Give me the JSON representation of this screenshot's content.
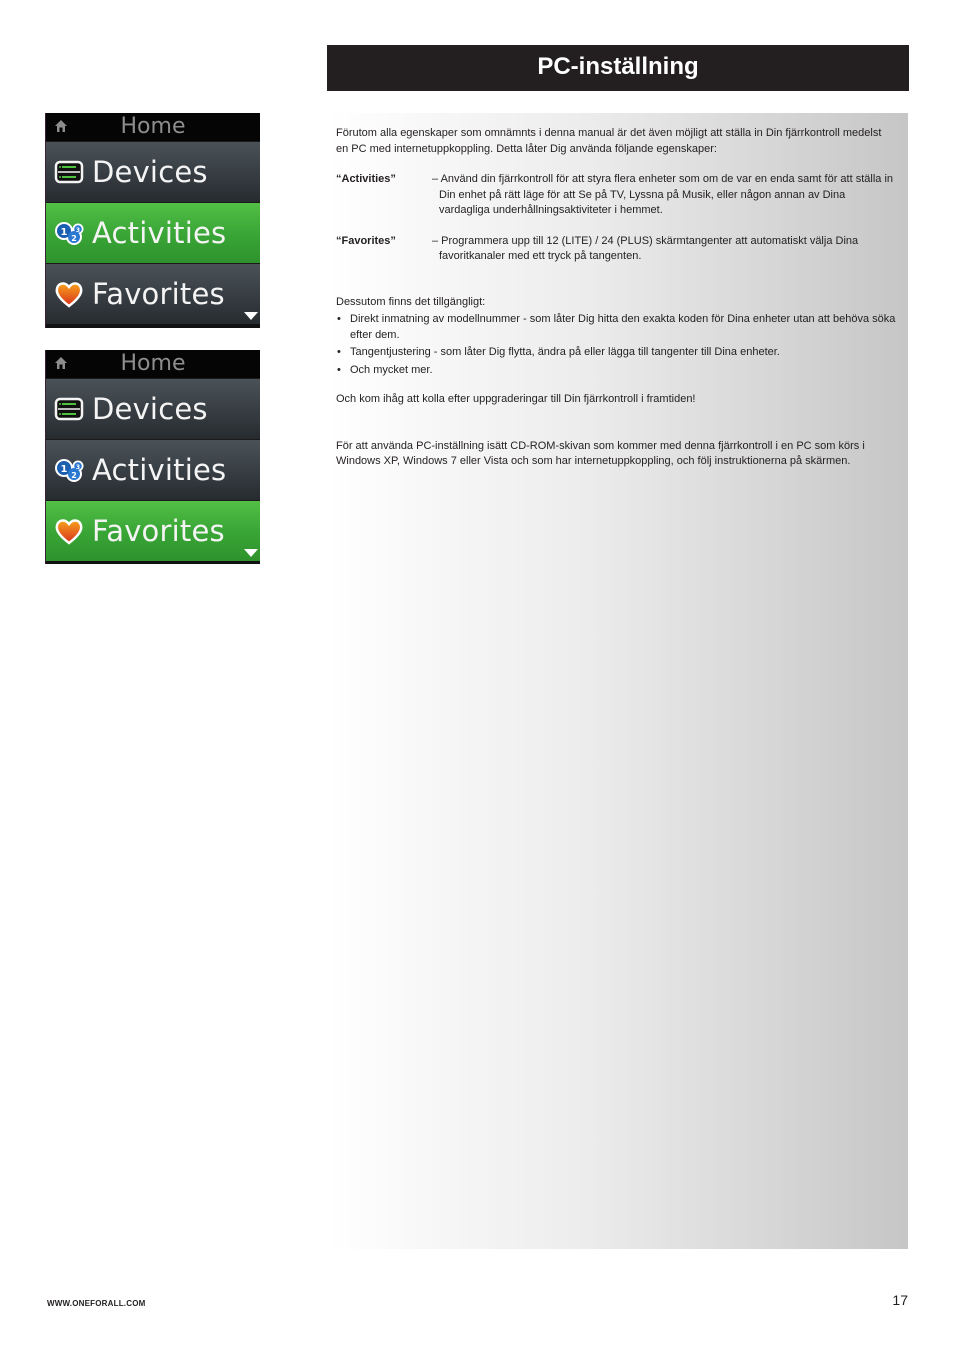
{
  "header": {
    "title": "PC-inställning"
  },
  "screens": [
    {
      "title": "Home",
      "items": [
        {
          "label": "Devices",
          "icon": "devices-icon",
          "selected": false
        },
        {
          "label": "Activities",
          "icon": "activities-icon",
          "selected": true
        },
        {
          "label": "Favorites",
          "icon": "heart-icon",
          "selected": false
        }
      ]
    },
    {
      "title": "Home",
      "items": [
        {
          "label": "Devices",
          "icon": "devices-icon",
          "selected": false
        },
        {
          "label": "Activities",
          "icon": "activities-icon",
          "selected": false
        },
        {
          "label": "Favorites",
          "icon": "heart-icon",
          "selected": true
        }
      ]
    }
  ],
  "colors": {
    "title_bar": "#231f20",
    "selected_item": "#3aa637",
    "unselected_item": "#3a4146",
    "panel_gradient_end": "#c6c6c6"
  },
  "body": {
    "intro": "Förutom alla egenskaper som omnämnts i denna manual är det även möjligt att ställa in Din fjärrkontroll medelst en PC med internetuppkoppling. Detta låter Dig använda följande egenskaper:",
    "definitions": [
      {
        "term": "“Activities”",
        "desc": "– Använd din fjärrkontroll för att styra flera enheter som om de var en enda samt för att ställa in Din enhet på rätt läge för att Se på TV, Lyssna på Musik, eller någon annan av Dina vardagliga underhållningsaktiviteter i hemmet."
      },
      {
        "term": "“Favorites”",
        "desc": "– Programmera upp till 12 (LITE) / 24 (PLUS) skärmtangenter att automatiskt välja Dina favoritkanaler med ett tryck på tangenten."
      }
    ],
    "also_heading": "Dessutom finns det tillgängligt:",
    "bullets": [
      "Direkt inmatning av modellnummer - som låter Dig hitta den exakta koden för Dina enheter utan att behöva söka efter dem.",
      "Tangentjustering - som låter Dig flytta, ändra på eller lägga till tangenter till Dina enheter.",
      "Och mycket mer."
    ],
    "reminder": "Och kom ihåg att kolla efter uppgraderingar till Din fjärrkontroll i framtiden!",
    "instructions": "För att använda PC-inställning isätt CD-ROM-skivan som kommer med denna fjärrkontroll i en PC som körs i Windows XP,  Windows 7 eller Vista och som har internetuppkoppling, och följ instruktionerna på skärmen."
  },
  "footer": {
    "url": "WWW.ONEFORALL.COM",
    "page_number": "17"
  }
}
